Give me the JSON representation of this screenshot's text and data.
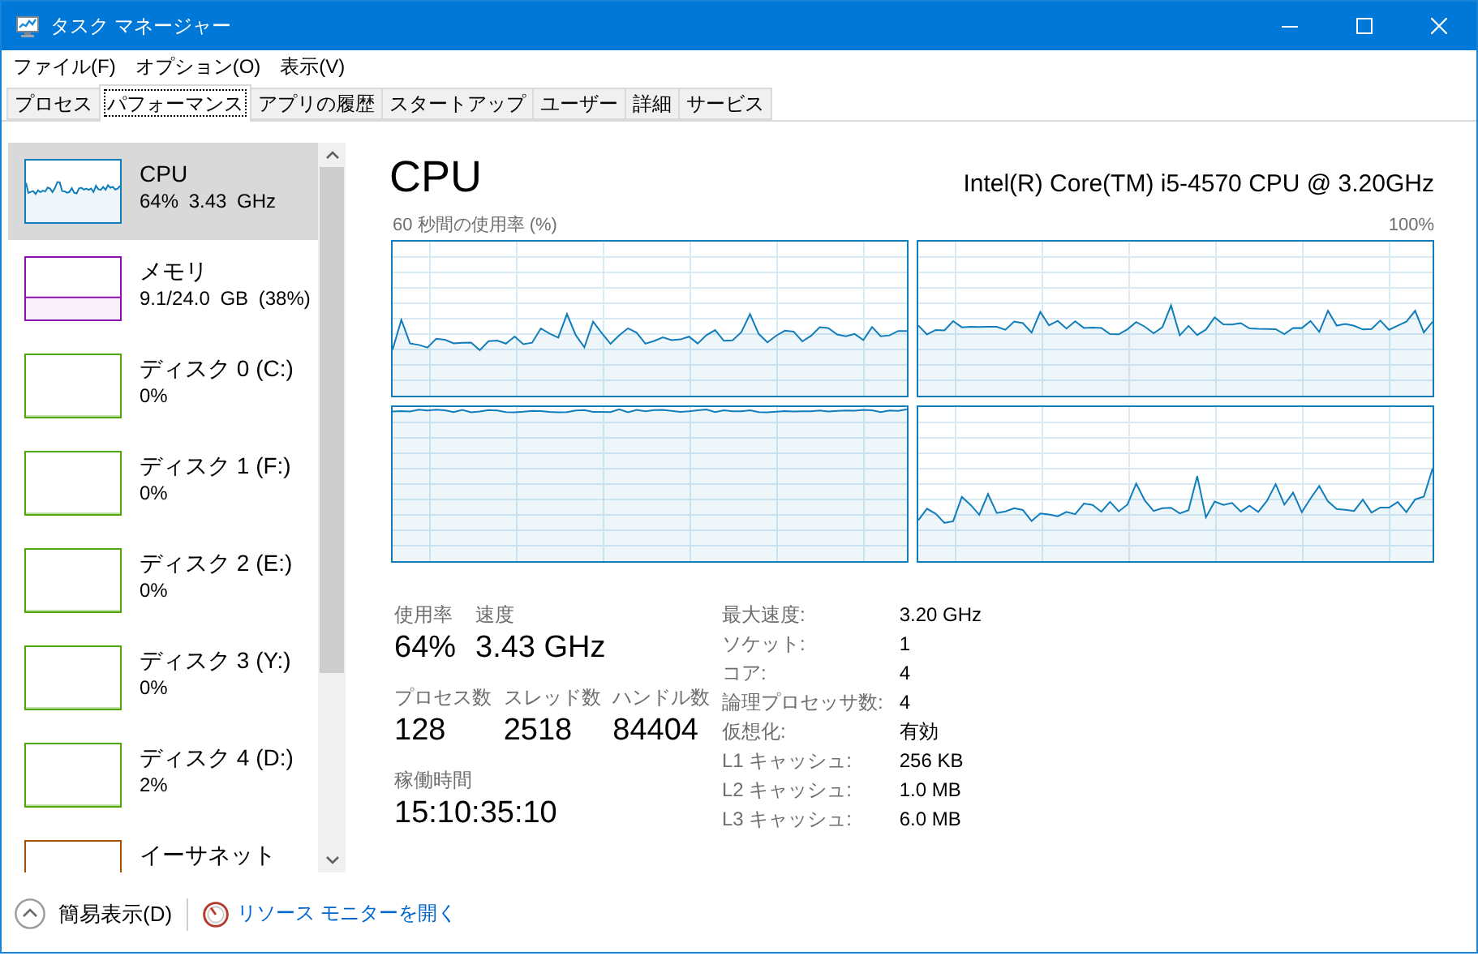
{
  "window": {
    "title": "タスク マネージャー"
  },
  "menu": [
    "ファイル(F)",
    "オプション(O)",
    "表示(V)"
  ],
  "tabs": [
    {
      "label": "プロセス",
      "selected": false
    },
    {
      "label": "パフォーマンス",
      "selected": true
    },
    {
      "label": "アプリの履歴",
      "selected": false
    },
    {
      "label": "スタートアップ",
      "selected": false
    },
    {
      "label": "ユーザー",
      "selected": false
    },
    {
      "label": "詳細",
      "selected": false
    },
    {
      "label": "サービス",
      "selected": false
    }
  ],
  "sidebar": {
    "items": [
      {
        "kind": "cpu",
        "name": "CPU",
        "reading": "64% 3.43 GHz",
        "color": "#117dbb",
        "selected": true
      },
      {
        "kind": "memory",
        "name": "メモリ",
        "reading": "9.1/24.0 GB (38%)",
        "color": "#8b12ae",
        "selected": false
      },
      {
        "kind": "disk",
        "name": "ディスク 0 (C:)",
        "reading": "0%",
        "color": "#4da60c",
        "selected": false
      },
      {
        "kind": "disk",
        "name": "ディスク 1 (F:)",
        "reading": "0%",
        "color": "#4da60c",
        "selected": false
      },
      {
        "kind": "disk",
        "name": "ディスク 2 (E:)",
        "reading": "0%",
        "color": "#4da60c",
        "selected": false
      },
      {
        "kind": "disk",
        "name": "ディスク 3 (Y:)",
        "reading": "0%",
        "color": "#4da60c",
        "selected": false
      },
      {
        "kind": "disk",
        "name": "ディスク 4 (D:)",
        "reading": "2%",
        "color": "#4da60c",
        "selected": false
      },
      {
        "kind": "ethernet",
        "name": "イーサネット",
        "color": "#a74f01",
        "selected": false
      }
    ]
  },
  "panel": {
    "title": "CPU",
    "model": "Intel(R) Core(TM) i5-4570 CPU @ 3.20GHz",
    "graph_caption": "60 秒間の使用率 (%)",
    "graph_max": "100%",
    "stats": [
      [
        {
          "label": "使用率",
          "value": "64%"
        },
        {
          "label": "速度",
          "value": "3.43 GHz"
        }
      ],
      [
        {
          "label": "プロセス数",
          "value": "128"
        },
        {
          "label": "スレッド数",
          "value": "2518"
        },
        {
          "label": "ハンドル数",
          "value": "84404"
        }
      ],
      [
        {
          "label": "稼働時間",
          "value": "15:10:35:10"
        }
      ]
    ],
    "details": [
      {
        "label": "最大速度:",
        "value": "3.20 GHz"
      },
      {
        "label": "ソケット:",
        "value": "1"
      },
      {
        "label": "コア:",
        "value": "4"
      },
      {
        "label": "論理プロセッサ数:",
        "value": "4"
      },
      {
        "label": "仮想化:",
        "value": "有効"
      },
      {
        "label": "L1 キャッシュ:",
        "value": "256 KB"
      },
      {
        "label": "L2 キャッシュ:",
        "value": "1.0 MB"
      },
      {
        "label": "L3 キャッシュ:",
        "value": "6.0 MB"
      }
    ]
  },
  "footer": {
    "compact_view": "簡易表示(D)",
    "resource_monitor": "リソース モニターを開く"
  }
}
